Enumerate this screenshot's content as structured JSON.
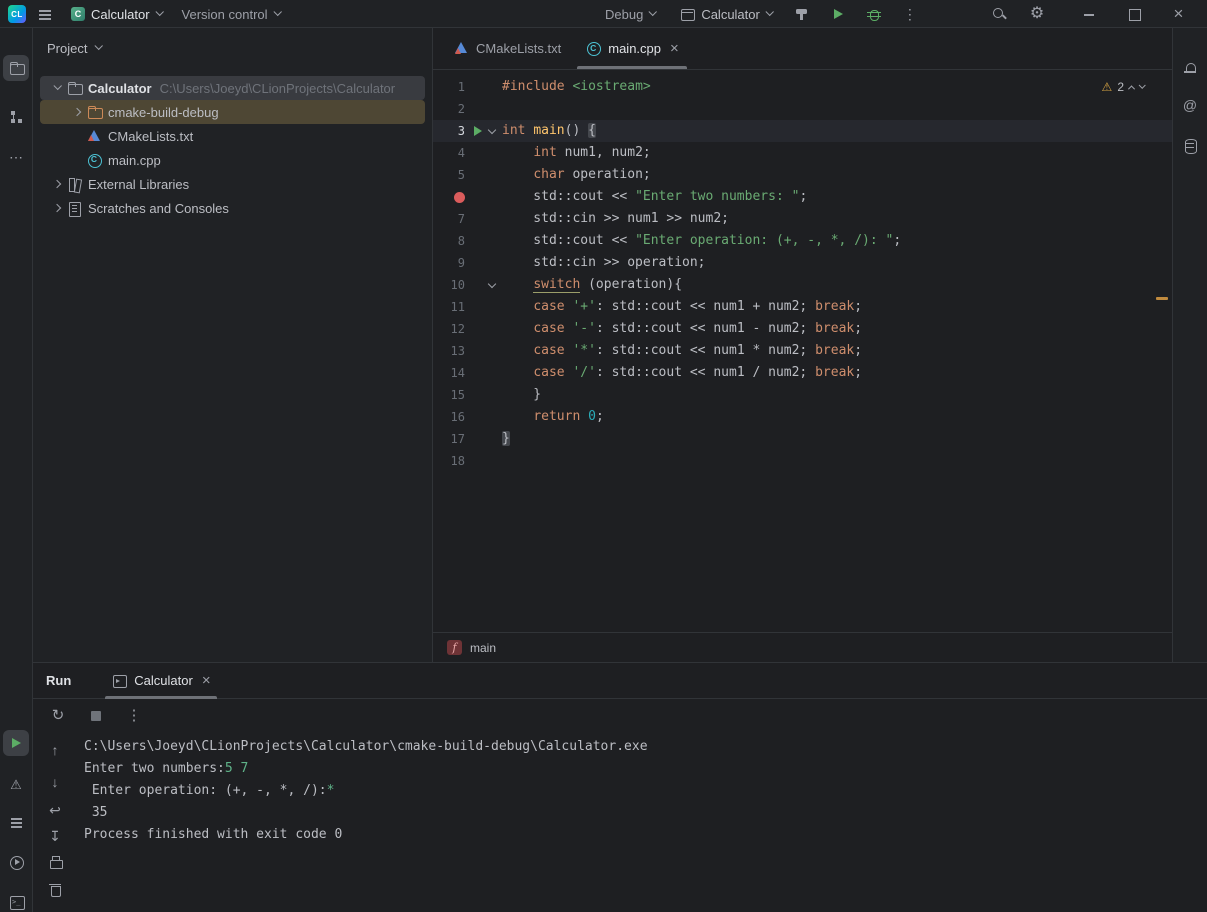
{
  "colors": {
    "bg_editor": "#1e1f22",
    "bg_panel": "#202225",
    "border": "#313438",
    "text": "#bcbec4",
    "text_dim": "#9da0a8",
    "text_faint": "#6f737a",
    "selection_gray": "#393b40",
    "selection_brown": "#4e4734",
    "current_line": "#26282e",
    "tab_underline": "#6e7177",
    "run_green": "#5cad65",
    "breakpoint_red": "#db5c5c",
    "warning_yellow": "#d6a343",
    "keyword": "#cf8e6d",
    "string": "#6aab73",
    "number": "#2aacb8",
    "function": "#ffc66d",
    "line_number": "#696e76",
    "console_input": "#5fb389",
    "folder_orange": "#cd8a58",
    "cmake_blue": "#5689d6",
    "cpp_teal": "#4cc2d4",
    "fn_red": "#c75450"
  },
  "glyphs": {
    "close": "×",
    "more_vertical": "⋮",
    "more_horizontal": "⋯",
    "up_arrow": "↑",
    "down_arrow": "↓",
    "soft_wrap": "↩",
    "scroll_to_end": "↧",
    "rerun": "↻",
    "warning": "⚠",
    "settings_gear": "⚙",
    "ai_assistant": "@",
    "chevron_note": ""
  },
  "titlebar": {
    "logo": "CL",
    "project_avatar": "C",
    "project_name": "Calculator",
    "version_control": "Version control",
    "build_type": "Debug",
    "run_config": "Calculator"
  },
  "project": {
    "header": "Project",
    "rows": [
      {
        "id": "calculator",
        "indent": 0,
        "chevron": "down",
        "icon": "folder",
        "label": "Calculator",
        "bold": true,
        "path": "C:\\Users\\Joeyd\\CLionProjects\\Calculator",
        "sel": "gray"
      },
      {
        "id": "cmake-build-debug",
        "indent": 1,
        "chevron": "right",
        "icon": "folder orange",
        "label": "cmake-build-debug",
        "sel": "brown"
      },
      {
        "id": "cmakelists-txt",
        "indent": 1,
        "chevron": "none",
        "icon": "cmake",
        "label": "CMakeLists.txt"
      },
      {
        "id": "main-cpp",
        "indent": 1,
        "chevron": "none",
        "icon": "cpp",
        "label": "main.cpp"
      },
      {
        "id": "external-libraries",
        "indent": 0,
        "chevron": "right",
        "icon": "library",
        "label": "External Libraries"
      },
      {
        "id": "scratches-and-consoles",
        "indent": 0,
        "chevron": "right",
        "icon": "scratch",
        "label": "Scratches and Consoles"
      }
    ]
  },
  "editor": {
    "tabs": [
      {
        "label": "CMakeLists.txt"
      },
      {
        "label": "main.cpp"
      }
    ],
    "warning_count": "2",
    "breadcrumb_icon": "f",
    "breadcrumb": "main",
    "lines": [
      {
        "n": "1",
        "tokens": [
          [
            "kw",
            "#include"
          ],
          [
            "pl",
            " "
          ],
          [
            "str",
            "<iostream>"
          ]
        ]
      },
      {
        "n": "2",
        "tokens": []
      },
      {
        "n": "3",
        "current": true,
        "run": true,
        "fold": true,
        "tokens": [
          [
            "kw",
            "int"
          ],
          [
            "pl",
            " "
          ],
          [
            "fn",
            "main"
          ],
          [
            "pl",
            "() "
          ],
          [
            "brace",
            "{"
          ]
        ]
      },
      {
        "n": "4",
        "tokens": [
          [
            "pl",
            "    "
          ],
          [
            "kw",
            "int"
          ],
          [
            "pl",
            " num1, num2;"
          ]
        ]
      },
      {
        "n": "5",
        "tokens": [
          [
            "pl",
            "    "
          ],
          [
            "kw",
            "char"
          ],
          [
            "pl",
            " operation;"
          ]
        ]
      },
      {
        "n": "6",
        "breakpoint": true,
        "tokens": [
          [
            "pl",
            "    std::cout "
          ],
          [
            "op",
            "<<"
          ],
          [
            "pl",
            " "
          ],
          [
            "str",
            "\"Enter two numbers: \""
          ],
          [
            "pl",
            ";"
          ]
        ]
      },
      {
        "n": "7",
        "tokens": [
          [
            "pl",
            "    std::cin "
          ],
          [
            "op",
            ">>"
          ],
          [
            "pl",
            " num1 "
          ],
          [
            "op",
            ">>"
          ],
          [
            "pl",
            " num2;"
          ]
        ]
      },
      {
        "n": "8",
        "tokens": [
          [
            "pl",
            "    std::cout "
          ],
          [
            "op",
            "<<"
          ],
          [
            "pl",
            " "
          ],
          [
            "str",
            "\"Enter operation: (+, -, *, /): \""
          ],
          [
            "pl",
            ";"
          ]
        ]
      },
      {
        "n": "9",
        "tokens": [
          [
            "pl",
            "    std::cin "
          ],
          [
            "op",
            ">>"
          ],
          [
            "pl",
            " operation;"
          ]
        ]
      },
      {
        "n": "10",
        "fold": true,
        "tokens": [
          [
            "pl",
            "    "
          ],
          [
            "kwu",
            "switch"
          ],
          [
            "pl",
            " (operation){"
          ]
        ]
      },
      {
        "n": "11",
        "tokens": [
          [
            "pl",
            "    "
          ],
          [
            "kw",
            "case"
          ],
          [
            "pl",
            " "
          ],
          [
            "str",
            "'+'"
          ],
          [
            "pl",
            ": std::cout "
          ],
          [
            "op",
            "<<"
          ],
          [
            "pl",
            " num1 + num2; "
          ],
          [
            "kw",
            "break"
          ],
          [
            "pl",
            ";"
          ]
        ]
      },
      {
        "n": "12",
        "tokens": [
          [
            "pl",
            "    "
          ],
          [
            "kw",
            "case"
          ],
          [
            "pl",
            " "
          ],
          [
            "str",
            "'-'"
          ],
          [
            "pl",
            ": std::cout "
          ],
          [
            "op",
            "<<"
          ],
          [
            "pl",
            " num1 - num2; "
          ],
          [
            "kw",
            "break"
          ],
          [
            "pl",
            ";"
          ]
        ]
      },
      {
        "n": "13",
        "tokens": [
          [
            "pl",
            "    "
          ],
          [
            "kw",
            "case"
          ],
          [
            "pl",
            " "
          ],
          [
            "str",
            "'*'"
          ],
          [
            "pl",
            ": std::cout "
          ],
          [
            "op",
            "<<"
          ],
          [
            "pl",
            " num1 * num2; "
          ],
          [
            "kw",
            "break"
          ],
          [
            "pl",
            ";"
          ]
        ]
      },
      {
        "n": "14",
        "tokens": [
          [
            "pl",
            "    "
          ],
          [
            "kw",
            "case"
          ],
          [
            "pl",
            " "
          ],
          [
            "str",
            "'/'"
          ],
          [
            "pl",
            ": std::cout "
          ],
          [
            "op",
            "<<"
          ],
          [
            "pl",
            " num1 / num2; "
          ],
          [
            "kw",
            "break"
          ],
          [
            "pl",
            ";"
          ]
        ]
      },
      {
        "n": "15",
        "tokens": [
          [
            "pl",
            "    }"
          ]
        ]
      },
      {
        "n": "16",
        "tokens": [
          [
            "pl",
            "    "
          ],
          [
            "kw",
            "return"
          ],
          [
            "pl",
            " "
          ],
          [
            "num",
            "0"
          ],
          [
            "pl",
            ";"
          ]
        ]
      },
      {
        "n": "17",
        "tokens": [
          [
            "brace",
            "}"
          ]
        ]
      },
      {
        "n": "18",
        "tokens": []
      }
    ]
  },
  "run": {
    "title": "Run",
    "tab_label": "Calculator",
    "console": [
      [
        [
          "pl",
          "C:\\Users\\Joeyd\\CLionProjects\\Calculator\\cmake-build-debug\\Calculator.exe"
        ]
      ],
      [
        [
          "pl",
          "Enter two numbers:"
        ],
        [
          "in",
          "5 7"
        ]
      ],
      [
        [
          "pl",
          " Enter operation: (+, -, *, /):"
        ],
        [
          "in",
          "*"
        ]
      ],
      [
        [
          "pl",
          " 35"
        ]
      ],
      [
        [
          "pl",
          "Process finished with exit code 0"
        ]
      ]
    ]
  }
}
